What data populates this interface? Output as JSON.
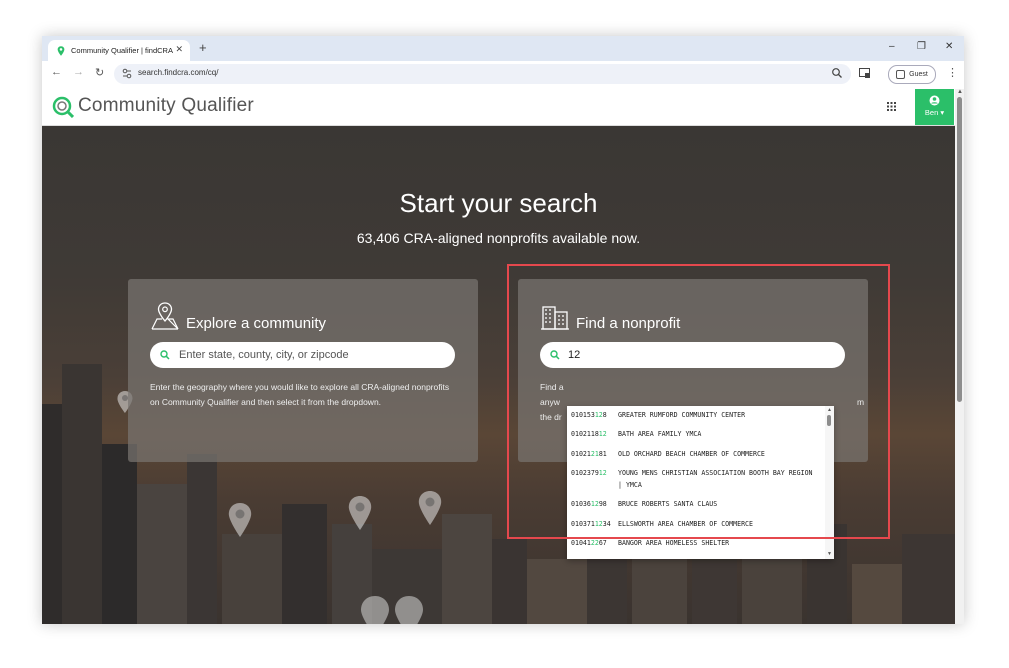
{
  "browser": {
    "tab_title": "Community Qualifier | findCRA",
    "new_tab": "+",
    "url": "search.findcra.com/cq/",
    "profile": "Guest",
    "window_controls": [
      "–",
      "❐",
      "✕"
    ]
  },
  "header": {
    "brand": "Community Qualifier",
    "user_name": "Ben ▾",
    "icons": [
      "cq-logo-icon",
      "apps-grid-icon",
      "user-icon"
    ]
  },
  "hero": {
    "title": "Start your search",
    "subtitle": "63,406 CRA-aligned nonprofits available now."
  },
  "explore": {
    "title": "Explore a community",
    "placeholder": "Enter state, county, city, or zipcode",
    "description": "Enter the geography where you would like to explore all CRA-aligned nonprofits on Community Qualifier and then select it from the dropdown."
  },
  "nonprofit": {
    "title": "Find a nonprofit",
    "query": "12",
    "desc_fragments": [
      "Find a",
      "anyw",
      "the dr"
    ],
    "desc_right": "m"
  },
  "dropdown": {
    "items": [
      {
        "pre": "010153",
        "hl": "12",
        "post": "8",
        "name": "GREATER RUMFORD COMMUNITY CENTER"
      },
      {
        "pre": "0102118",
        "hl": "12",
        "post": "",
        "name": "BATH AREA FAMILY YMCA"
      },
      {
        "pre": "01021",
        "hl": "21",
        "post": "81",
        "name": "OLD ORCHARD BEACH CHAMBER OF COMMERCE"
      },
      {
        "pre": "0102379",
        "hl": "12",
        "post": "",
        "name": "YOUNG MENS CHRISTIAN ASSOCIATION BOOTH BAY REGION | YMCA"
      },
      {
        "pre": "01036",
        "hl": "12",
        "post": "98",
        "name": "BRUCE ROBERTS SANTA CLAUS"
      },
      {
        "pre": "010371",
        "hl": "12",
        "post": "34",
        "name": "ELLSWORTH AREA CHAMBER OF COMMERCE"
      },
      {
        "pre": "01041",
        "hl": "22",
        "post": "67",
        "name": "BANGOR AREA HOMELESS SHELTER"
      }
    ]
  },
  "colors": {
    "accent": "#2bbf69",
    "annotation": "#e5484d"
  }
}
